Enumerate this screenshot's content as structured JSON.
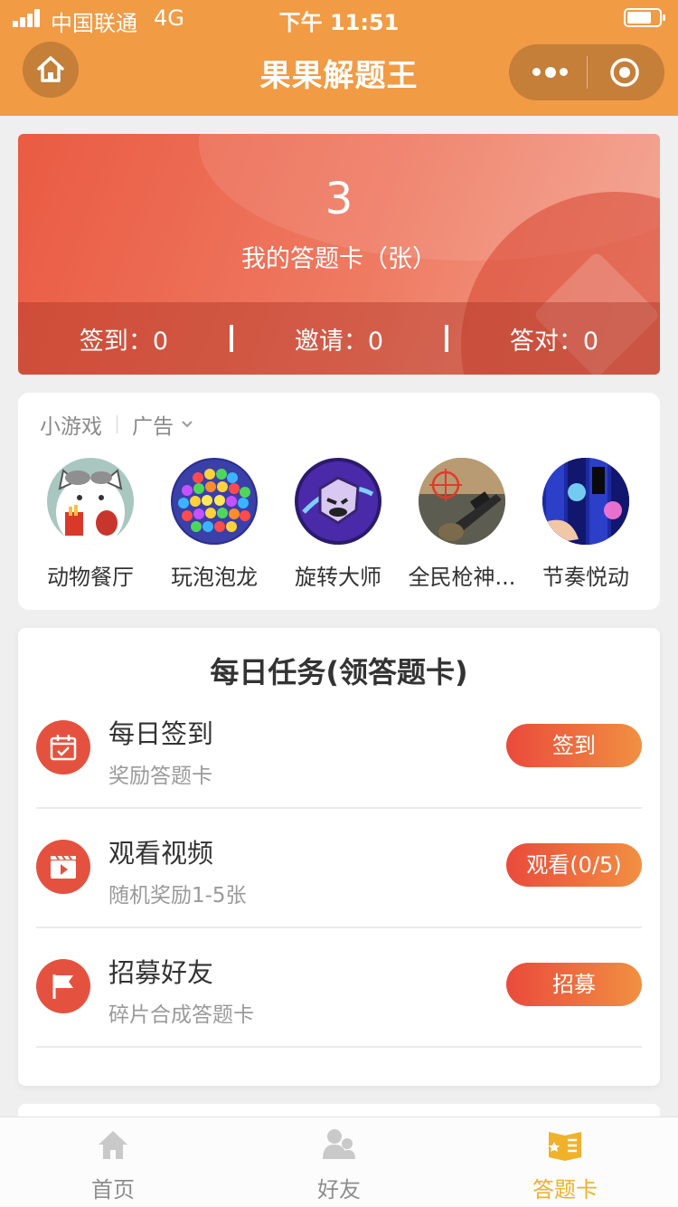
{
  "status_bar": {
    "carrier": "中国联通",
    "network": "4G",
    "time": "下午 11:51"
  },
  "nav": {
    "title": "果果解题王",
    "home_icon": "home-icon",
    "more_icon": "more-icon",
    "close_icon": "target-icon"
  },
  "card_summary": {
    "count": "3",
    "label": "我的答题卡（张）",
    "stats": [
      {
        "label": "签到：0"
      },
      {
        "label": "邀请：0"
      },
      {
        "label": "答对：0"
      }
    ]
  },
  "games": {
    "tab_games": "小游戏",
    "tab_ads": "广告",
    "items": [
      {
        "name": "动物餐厅"
      },
      {
        "name": "玩泡泡龙"
      },
      {
        "name": "旋转大师"
      },
      {
        "name": "全民枪神..."
      },
      {
        "name": "节奏悦动"
      }
    ]
  },
  "tasks": {
    "title": "每日任务(领答题卡)",
    "items": [
      {
        "title": "每日签到",
        "desc": "奖励答题卡",
        "button": "签到",
        "icon": "calendar-icon"
      },
      {
        "title": "观看视频",
        "desc": "随机奖励1-5张",
        "button": "观看(0/5)",
        "icon": "video-icon"
      },
      {
        "title": "招募好友",
        "desc": "碎片合成答题卡",
        "button": "招募",
        "icon": "flag-icon"
      }
    ]
  },
  "tabbar": {
    "items": [
      {
        "label": "首页",
        "icon": "home-icon"
      },
      {
        "label": "好友",
        "icon": "friends-icon"
      },
      {
        "label": "答题卡",
        "icon": "card-book-icon"
      }
    ],
    "active_index": 2
  },
  "colors": {
    "header": "#f19b45",
    "accent_red": "#e4523f",
    "active_tab": "#f0b12b"
  }
}
